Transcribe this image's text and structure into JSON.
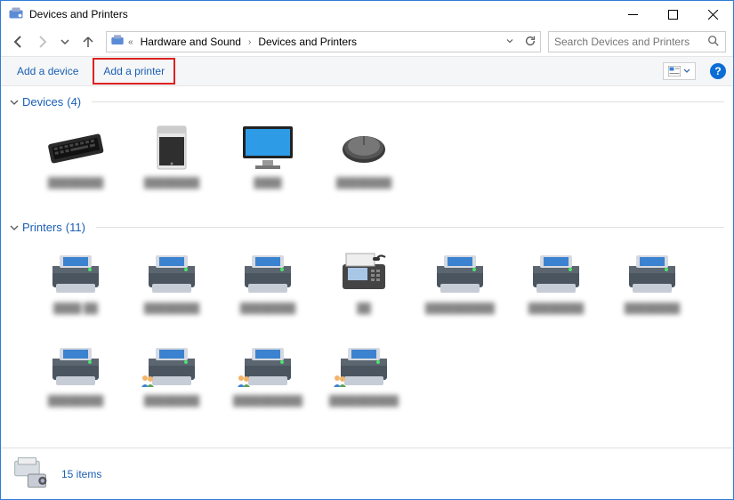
{
  "window": {
    "title": "Devices and Printers"
  },
  "breadcrumbs": {
    "back_chev": "«",
    "p1": "Hardware and Sound",
    "p2": "Devices and Printers"
  },
  "search": {
    "placeholder": "Search Devices and Printers"
  },
  "toolbar": {
    "add_device": "Add a device",
    "add_printer": "Add a printer"
  },
  "groups": {
    "devices": {
      "title": "Devices",
      "count": "(4)"
    },
    "printers": {
      "title": "Printers",
      "count": "(11)"
    }
  },
  "devices": [
    {
      "label": "████████",
      "icon": "keyboard"
    },
    {
      "label": "████████",
      "icon": "pc"
    },
    {
      "label": "████",
      "icon": "monitor"
    },
    {
      "label": "████████",
      "icon": "mouse"
    }
  ],
  "printers": [
    {
      "label": "████ ██",
      "shared": false
    },
    {
      "label": "████████",
      "shared": false
    },
    {
      "label": "████████",
      "shared": false
    },
    {
      "label": "██",
      "shared": false,
      "fax": true
    },
    {
      "label": "██████████",
      "shared": false
    },
    {
      "label": "████████",
      "shared": false
    },
    {
      "label": "████████",
      "shared": false
    },
    {
      "label": "████████",
      "shared": false
    },
    {
      "label": "████████",
      "shared": true
    },
    {
      "label": "██████████",
      "shared": true
    },
    {
      "label": "██████████",
      "shared": true
    }
  ],
  "status": {
    "text": "15 items"
  }
}
